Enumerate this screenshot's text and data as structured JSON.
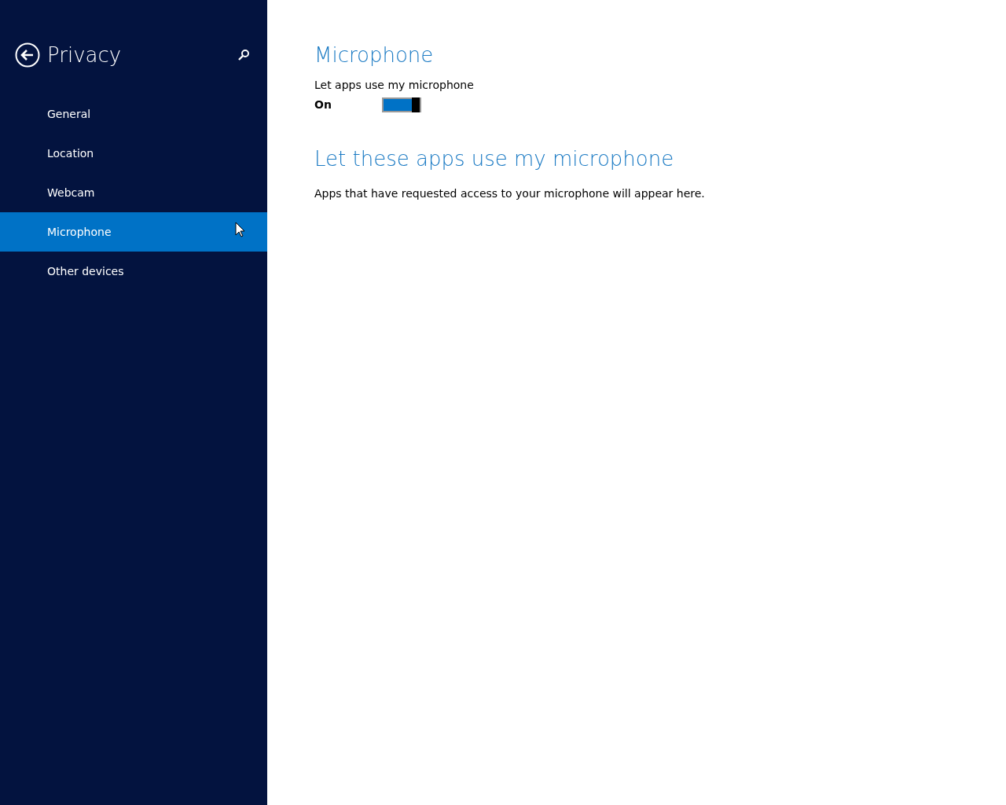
{
  "sidebar": {
    "title": "Privacy",
    "items": [
      {
        "label": "General",
        "selected": false
      },
      {
        "label": "Location",
        "selected": false
      },
      {
        "label": "Webcam",
        "selected": false
      },
      {
        "label": "Microphone",
        "selected": true
      },
      {
        "label": "Other devices",
        "selected": false
      }
    ]
  },
  "content": {
    "heading": "Microphone",
    "setting": {
      "label": "Let apps use my microphone",
      "state_text": "On",
      "on": true
    },
    "apps_heading": "Let these apps use my microphone",
    "apps_note": "Apps that have requested access to your microphone will appear here."
  }
}
